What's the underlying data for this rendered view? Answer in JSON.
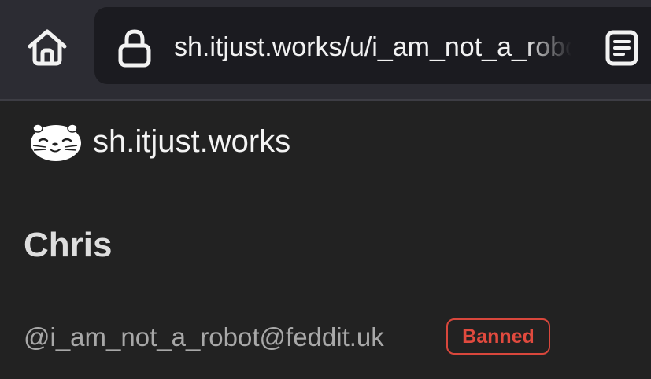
{
  "browser": {
    "url": "sh.itjust.works/u/i_am_not_a_robot@feddit.uk",
    "home_icon": "home-icon",
    "lock_icon": "lock-icon",
    "reader_icon": "reader-view-icon"
  },
  "site": {
    "logo_icon": "otter-logo-icon",
    "name": "sh.itjust.works"
  },
  "profile": {
    "display_name": "Chris",
    "handle": "@i_am_not_a_robot@feddit.uk",
    "status_badge": "Banned"
  },
  "colors": {
    "background": "#222222",
    "toolbar": "#2c2c33",
    "url_field": "#1b1b20",
    "badge_red": "#e14a3e"
  }
}
